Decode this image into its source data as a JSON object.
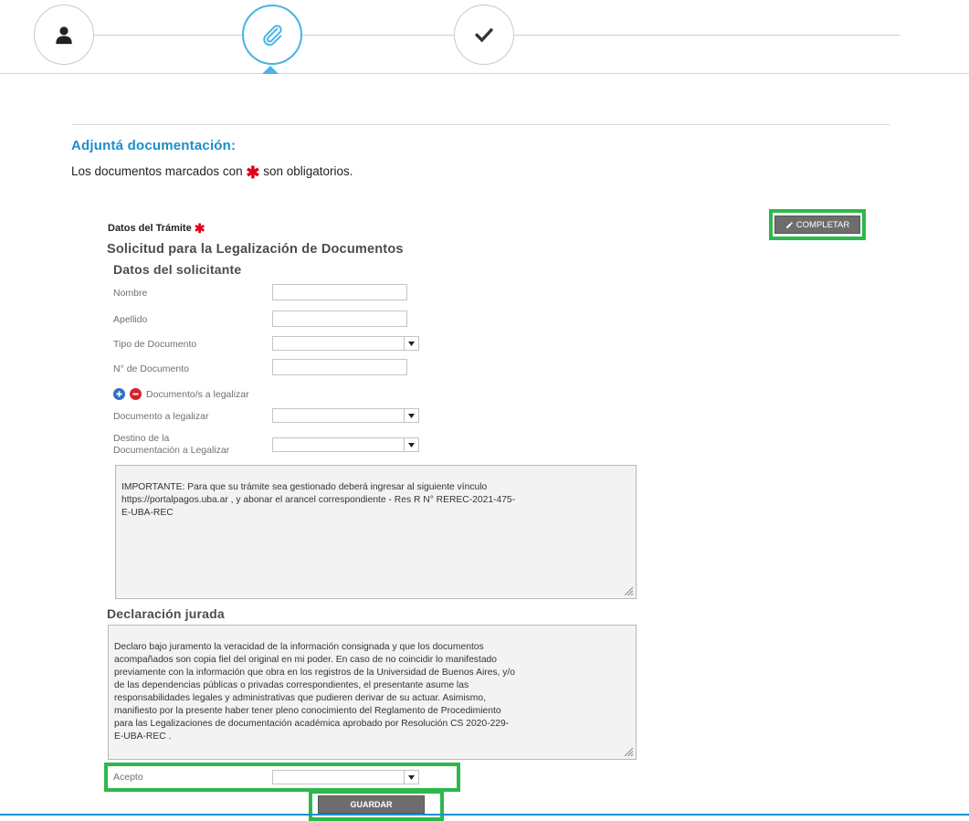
{
  "section": {
    "title": "Adjuntá documentación:",
    "note_prefix": "Los documentos marcados con",
    "note_suffix": "son obligatorios.",
    "required_mark": "✱"
  },
  "tramite": {
    "label": "Datos del Trámite",
    "completar_label": "COMPLETAR"
  },
  "form": {
    "title": "Solicitud para la Legalización de Documentos",
    "subtitle": "Datos del solicitante",
    "fields": {
      "nombre_label": "Nombre",
      "nombre_value": "",
      "apellido_label": "Apellido",
      "apellido_value": "",
      "tipo_doc_label": "Tipo de Documento",
      "tipo_doc_value": "",
      "nro_doc_label": "N° de Documento",
      "nro_doc_value": "",
      "documentos_label": "Documento/s a legalizar",
      "doc_legalizar_label": "Documento a legalizar",
      "doc_legalizar_value": "",
      "destino_label_line1": "Destino de la",
      "destino_label_line2": "Documentación a Legalizar",
      "destino_value": ""
    },
    "importante_text": "IMPORTANTE: Para que su trámite sea gestionado deberá ingresar al siguiente vínculo\nhttps://portalpagos.uba.ar , y abonar el arancel correspondiente  - Res R N° REREC-2021-475-\nE-UBA-REC",
    "declaracion_title": "Declaración jurada",
    "declaracion_text": "Declaro bajo juramento la veracidad de la información consignada y que los documentos\nacompañados son copia fiel del original en mi poder. En caso de no coincidir lo manifestado\npreviamente con la información que obra en los registros de la Universidad de Buenos Aires, y/o\nde las dependencias públicas o privadas correspondientes, el presentante asume las\nresponsabilidades legales y administrativas que pudieren derivar de su actuar. Asimismo,\nmanifiesto por la presente haber tener pleno conocimiento del Reglamento de Procedimiento\npara las Legalizaciones de documentación académica aprobado por Resolución CS 2020-229-\nE-UBA-REC .",
    "acepto_label": "Acepto",
    "acepto_value": "",
    "guardar_label": "GUARDAR"
  },
  "colors": {
    "accent": "#1b8ecb",
    "step_active": "#49b3e6",
    "highlight": "#2db84b",
    "required": "#e0001b",
    "button": "#6d6d6d"
  },
  "icons": {
    "step1": "user-icon",
    "step2": "paperclip-icon",
    "step3": "checkmark-icon"
  }
}
